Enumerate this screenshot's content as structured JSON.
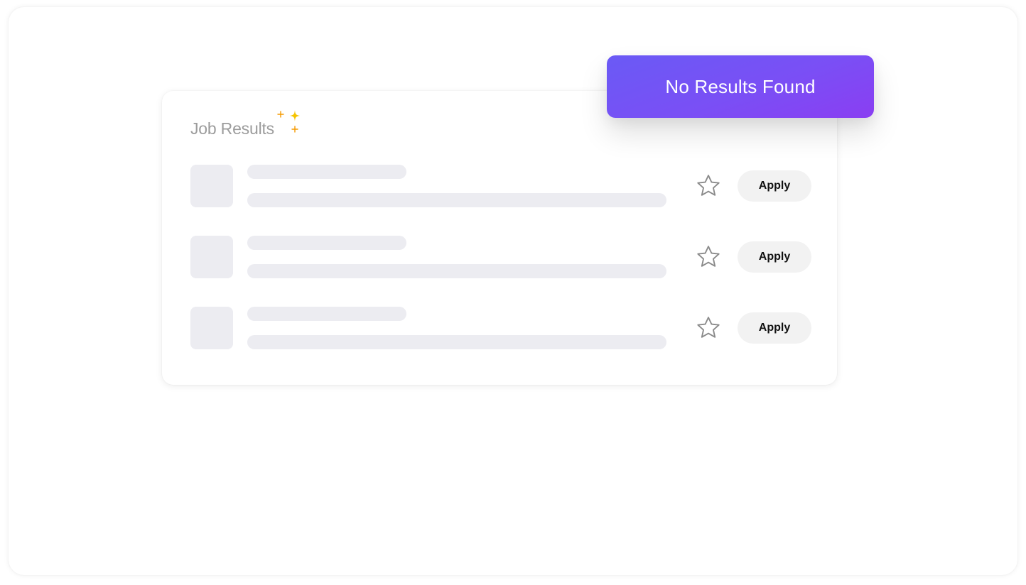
{
  "card": {
    "title": "Job Results",
    "rows": [
      {
        "apply_label": "Apply",
        "favorited": false
      },
      {
        "apply_label": "Apply",
        "favorited": false
      },
      {
        "apply_label": "Apply",
        "favorited": false
      }
    ]
  },
  "toast": {
    "message": "No Results Found"
  },
  "icons": {
    "sparkles": "sparkles-icon",
    "favorite": "star-outline-icon"
  },
  "colors": {
    "toast_gradient_start": "#6a5af5",
    "toast_gradient_end": "#8a3ef2",
    "sparkle_large": "#f5c400",
    "sparkle_small": "#f59a00",
    "skeleton": "#ececf1",
    "apply_bg": "#f2f2f2"
  }
}
